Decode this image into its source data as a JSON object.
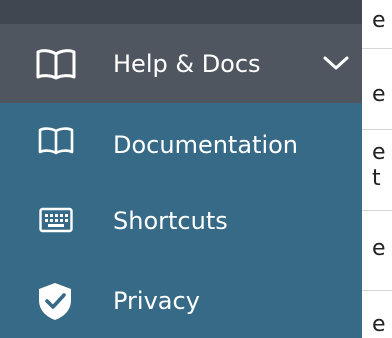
{
  "menu": {
    "header": {
      "label": "Help & Docs",
      "icon": "book-open-icon",
      "expanded_indicator": "chevron-down-icon"
    },
    "items": [
      {
        "label": "Documentation",
        "icon": "book-open-icon"
      },
      {
        "label": "Shortcuts",
        "icon": "keyboard-icon"
      },
      {
        "label": "Privacy",
        "icon": "shield-check-icon"
      }
    ]
  },
  "background_page": {
    "visible_chars": [
      "e",
      "e",
      "e",
      "t",
      "e",
      "e"
    ]
  },
  "colors": {
    "top_strip": "#414751",
    "header_bg": "#505660",
    "submenu_bg": "#366a86",
    "text": "#ffffff"
  }
}
